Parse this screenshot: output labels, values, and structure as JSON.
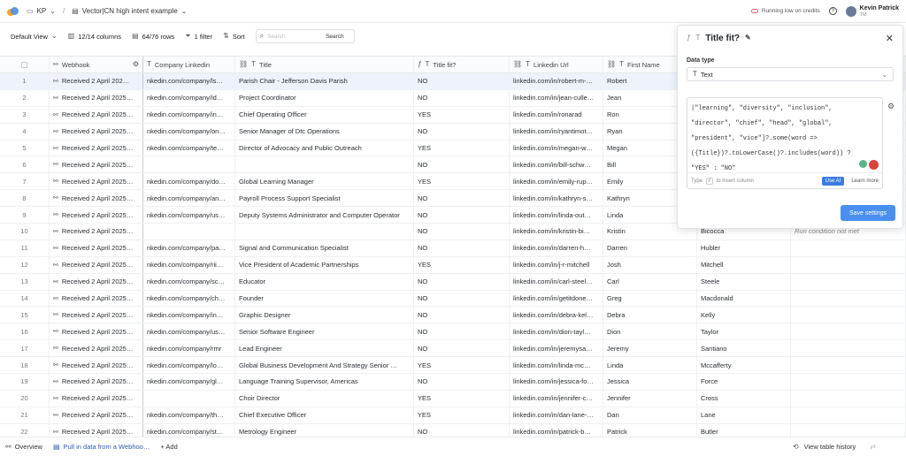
{
  "topbar": {
    "workspace": "KP",
    "table_title": "Vector|CN high intent example",
    "credits_status": "Running low on credits",
    "user_name": "Kevin Patrick",
    "user_sub": "TM"
  },
  "toolbar": {
    "view": "Default View",
    "columns": "12/14 columns",
    "rows": "64/76 rows",
    "filter": "1 filter",
    "sort": "Sort",
    "search_placeholder": "Search",
    "search_button": "Search"
  },
  "columns": [
    "Webhook",
    "Company Linkedin",
    "Title",
    "Title fit?",
    "Linkedin Url",
    "First Name"
  ],
  "rows": [
    {
      "n": "1",
      "webhook": "Received 2 April 202…",
      "company": "nkedin.com/company/ls…",
      "title": "Parish Chair - Jefferson Davis Parish",
      "fit": "NO",
      "url": "linkedin.com/in/robert-m-…",
      "first": "Robert",
      "last": "",
      "note": ""
    },
    {
      "n": "2",
      "webhook": "Received 2 April 2025…",
      "company": "nkedin.com/company/id…",
      "title": "Project Coordinator",
      "fit": "NO",
      "url": "linkedin.com/in/jean-culle…",
      "first": "Jean",
      "last": "",
      "note": ""
    },
    {
      "n": "3",
      "webhook": "Received 2 April 2025…",
      "company": "nkedin.com/company/in…",
      "title": "Chief Operating Officer",
      "fit": "YES",
      "url": "linkedin.com/in/ronarad",
      "first": "Ron",
      "last": "",
      "note": ""
    },
    {
      "n": "4",
      "webhook": "Received 2 April 2025…",
      "company": "nkedin.com/company/on…",
      "title": "Senior Manager of Dtc Operations",
      "fit": "NO",
      "url": "linkedin.com/in/ryantimot…",
      "first": "Ryan",
      "last": "",
      "note": ""
    },
    {
      "n": "5",
      "webhook": "Received 2 April 2025…",
      "company": "nkedin.com/company/te…",
      "title": "Director of Advocacy and Public Outreach",
      "fit": "YES",
      "url": "linkedin.com/in/megan-w…",
      "first": "Megan",
      "last": "",
      "note": ""
    },
    {
      "n": "6",
      "webhook": "Received 2 April 2025…",
      "company": "",
      "title": "",
      "fit": "NO",
      "url": "linkedin.com/in/bill-schw…",
      "first": "Bill",
      "last": "",
      "note": ""
    },
    {
      "n": "7",
      "webhook": "Received 2 April 2025…",
      "company": "nkedin.com/company/do…",
      "title": "Global Learning Manager",
      "fit": "YES",
      "url": "linkedin.com/in/emily-rup…",
      "first": "Emily",
      "last": "",
      "note": ""
    },
    {
      "n": "8",
      "webhook": "Received 2 April 2025…",
      "company": "nkedin.com/company/an…",
      "title": "Payroll Process Support Specialist",
      "fit": "NO",
      "url": "linkedin.com/in/kathryn-s…",
      "first": "Kathryn",
      "last": "",
      "note": ""
    },
    {
      "n": "9",
      "webhook": "Received 2 April 2025…",
      "company": "nkedin.com/company/us…",
      "title": "Deputy Systems Administrator and Computer Operator",
      "fit": "NO",
      "url": "linkedin.com/in/linda-out…",
      "first": "Linda",
      "last": "",
      "note": ""
    },
    {
      "n": "10",
      "webhook": "Received 2 April 2025…",
      "company": "",
      "title": "",
      "fit": "NO",
      "url": "linkedin.com/in/kristin-bi…",
      "first": "Kristin",
      "last": "Bicocca",
      "note": "Run condition not met"
    },
    {
      "n": "11",
      "webhook": "Received 2 April 2025…",
      "company": "nkedin.com/company/pa…",
      "title": "Signal and Communication Specialist",
      "fit": "NO",
      "url": "linkedin.com/in/darren-h…",
      "first": "Darren",
      "last": "Hubler",
      "note": ""
    },
    {
      "n": "12",
      "webhook": "Received 2 April 2025…",
      "company": "nkedin.com/company/rii…",
      "title": "Vice President of Academic Partnerships",
      "fit": "YES",
      "url": "linkedin.com/in/j-r-mitchell",
      "first": "Josh",
      "last": "Mitchell",
      "note": ""
    },
    {
      "n": "13",
      "webhook": "Received 2 April 2025…",
      "company": "nkedin.com/company/sc…",
      "title": "Educator",
      "fit": "NO",
      "url": "linkedin.com/in/carl-steel…",
      "first": "Carl",
      "last": "Steele",
      "note": ""
    },
    {
      "n": "14",
      "webhook": "Received 2 April 2025…",
      "company": "nkedin.com/company/ch…",
      "title": "Founder",
      "fit": "NO",
      "url": "linkedin.com/in/getitdone…",
      "first": "Greg",
      "last": "Macdonald",
      "note": ""
    },
    {
      "n": "15",
      "webhook": "Received 2 April 2025…",
      "company": "nkedin.com/company/in…",
      "title": "Graphic Designer",
      "fit": "NO",
      "url": "linkedin.com/in/debra-kel…",
      "first": "Debra",
      "last": "Kelly",
      "note": ""
    },
    {
      "n": "16",
      "webhook": "Received 2 April 2025…",
      "company": "nkedin.com/company/us…",
      "title": "Senior Software Engineer",
      "fit": "NO",
      "url": "linkedin.com/in/dion-tayl…",
      "first": "Dion",
      "last": "Taylor",
      "note": ""
    },
    {
      "n": "17",
      "webhook": "Received 2 April 2025…",
      "company": "nkedin.com/company/rmr",
      "title": "Lead Engineer",
      "fit": "NO",
      "url": "linkedin.com/in/jeremysa…",
      "first": "Jeremy",
      "last": "Santiano",
      "note": ""
    },
    {
      "n": "18",
      "webhook": "Received 2 April 2025…",
      "company": "nkedin.com/company/lo…",
      "title": "Global Business Development And Strategy Senior …",
      "fit": "YES",
      "url": "linkedin.com/in/linda-mc…",
      "first": "Linda",
      "last": "Mccafferty",
      "note": ""
    },
    {
      "n": "19",
      "webhook": "Received 2 April 2025…",
      "company": "nkedin.com/company/gl…",
      "title": "Language Training Supervisor, Americas",
      "fit": "NO",
      "url": "linkedin.com/in/jessica-fo…",
      "first": "Jessica",
      "last": "Force",
      "note": ""
    },
    {
      "n": "20",
      "webhook": "Received 2 April 2025…",
      "company": "",
      "title": "Choir Director",
      "fit": "YES",
      "url": "linkedin.com/in/jennifer-c…",
      "first": "Jennifer",
      "last": "Cross",
      "note": ""
    },
    {
      "n": "21",
      "webhook": "Received 2 April 2025…",
      "company": "nkedin.com/company/th…",
      "title": "Chief Executive Officer",
      "fit": "YES",
      "url": "linkedin.com/in/dan-lane-…",
      "first": "Dan",
      "last": "Lane",
      "note": ""
    },
    {
      "n": "22",
      "webhook": "Received 2 April 2025…",
      "company": "nkedin.com/company/st…",
      "title": "Metrology Engineer",
      "fit": "NO",
      "url": "linkedin.com/in/patrick-b…",
      "first": "Patrick",
      "last": "Butler",
      "note": ""
    }
  ],
  "panel": {
    "title": "Title fit?",
    "data_type_label": "Data type",
    "data_type_value": "Text",
    "formula_lines": [
      "|\"learning\", \"diversity\", \"inclusion\",",
      "\"director\", \"chief\", \"head\", \"global\",",
      "\"president\", \"vice\"]?.some(word =>",
      "({Title})?.toLowerCase()?.includes(word)) ?",
      "\"YES\" : \"NO\""
    ],
    "hint_type": "Type",
    "hint_key": "/",
    "hint_rest": "to insert column",
    "use_ai": "Use AI",
    "learn_more": "Learn more",
    "save": "Save settings"
  },
  "bottombar": {
    "overview": "Overview",
    "active_tab": "Pull in data from a Webhoo…",
    "add": "+ Add",
    "history": "View table history"
  }
}
